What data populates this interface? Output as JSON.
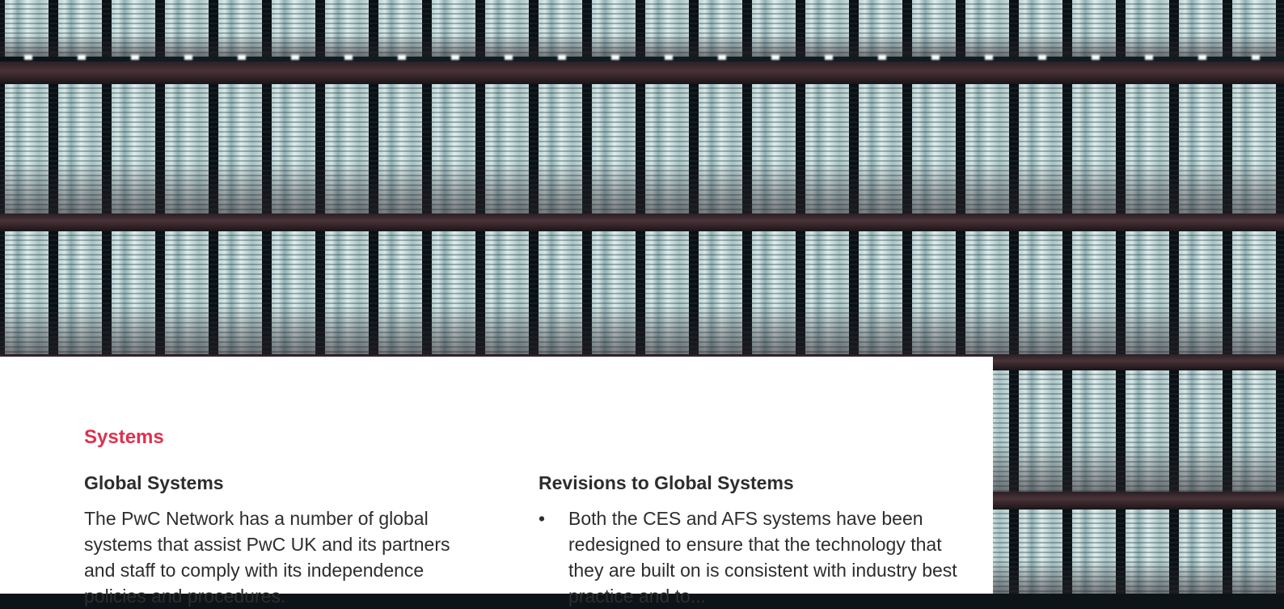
{
  "section": {
    "title": "Systems"
  },
  "left_column": {
    "heading": "Global Systems",
    "body": "The PwC Network has a number of global systems that assist PwC UK and its partners and staff to comply with its independence policies and procedures."
  },
  "right_column": {
    "heading": "Revisions to Global Systems",
    "bullets": [
      {
        "symbol": "•",
        "text": "Both the CES and AFS systems have been redesigned to ensure that the technology that they are built on is consistent with industry best practice and to..."
      }
    ]
  },
  "colors": {
    "accent": "#e0304e",
    "body_text": "#2d2d2d",
    "panel": "#ffffff"
  }
}
